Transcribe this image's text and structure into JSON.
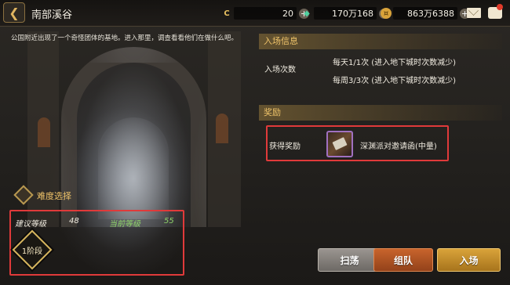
{
  "header": {
    "back_icon": "back-arrow-icon",
    "title": "南部溪谷"
  },
  "currencies": [
    {
      "icon": "c-token-icon",
      "value": "20"
    },
    {
      "icon": "green-gem-icon",
      "value": "170万168"
    },
    {
      "icon": "gold-coin-icon",
      "value": "863万6388"
    }
  ],
  "toolbar_icons": [
    "mail-icon",
    "chat-icon"
  ],
  "description": "公国附近出现了一个奇怪团体的基地。进入那里，调查看看他们在做什么吧。",
  "entry_info": {
    "header": "入场信息",
    "label": "入场次数",
    "daily": "每天1/1次 (进入地下城时次数减少)",
    "weekly": "每周3/3次 (进入地下城时次数减少)"
  },
  "reward": {
    "header": "奖励",
    "label": "获得奖励",
    "item_name": "深渊派对邀请函(中量)"
  },
  "difficulty": {
    "title": "难度选择",
    "recommended_label": "建议等级",
    "recommended_value": "48",
    "current_label": "当前等级",
    "current_value": "55",
    "stage": "1阶段"
  },
  "buttons": {
    "sweep": "扫荡",
    "team": "组队",
    "enter": "入场"
  },
  "colors": {
    "accent_gold": "#f0c46a",
    "highlight_red": "#e03a3a",
    "team_button": "#c8642c",
    "enter_button": "#d9a33a",
    "level_green": "#8fd36a"
  }
}
